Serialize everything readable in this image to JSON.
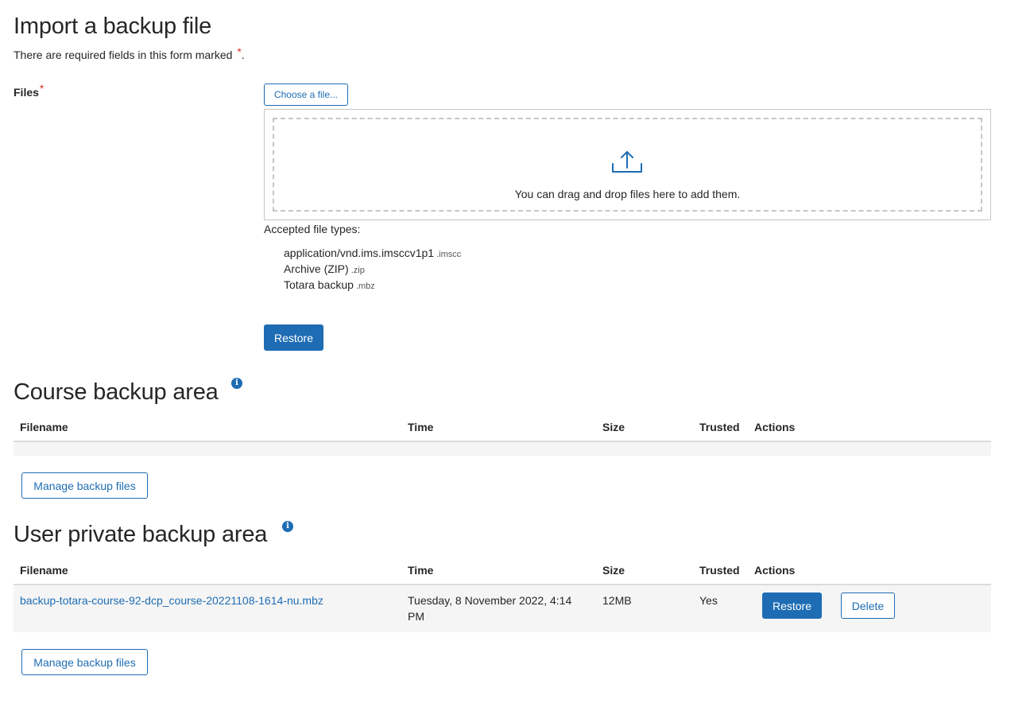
{
  "page": {
    "title": "Import a backup file",
    "required_note": "There are required fields in this form marked",
    "required_note_star": "*",
    "required_note_period": "."
  },
  "files_field": {
    "label": "Files",
    "required_star": "*",
    "choose_button": "Choose a file...",
    "drop_text": "You can drag and drop files here to add them.",
    "upload_icon": "upload-icon",
    "accepted_label": "Accepted file types:",
    "accepted_types": [
      {
        "name": "application/vnd.ims.imsccv1p1",
        "ext": ".imscc"
      },
      {
        "name": "Archive (ZIP)",
        "ext": ".zip"
      },
      {
        "name": "Totara backup",
        "ext": ".mbz"
      }
    ],
    "restore_button": "Restore"
  },
  "course_backup": {
    "title": "Course backup area",
    "info_icon": "info-icon",
    "columns": [
      "Filename",
      "Time",
      "Size",
      "Trusted",
      "Actions"
    ],
    "rows": [],
    "manage_button": "Manage backup files"
  },
  "user_backup": {
    "title": "User private backup area",
    "info_icon": "info-icon",
    "columns": [
      "Filename",
      "Time",
      "Size",
      "Trusted",
      "Actions"
    ],
    "rows": [
      {
        "filename": "backup-totara-course-92-dcp_course-20221108-1614-nu.mbz",
        "time": "Tuesday, 8 November 2022, 4:14 PM",
        "size": "12MB",
        "trusted": "Yes",
        "restore_label": "Restore",
        "delete_label": "Delete"
      }
    ],
    "manage_button": "Manage backup files"
  },
  "colors": {
    "accent": "#1e6db4",
    "required": "#d9342b",
    "text": "#262626",
    "row_background": "#f5f5f5"
  }
}
